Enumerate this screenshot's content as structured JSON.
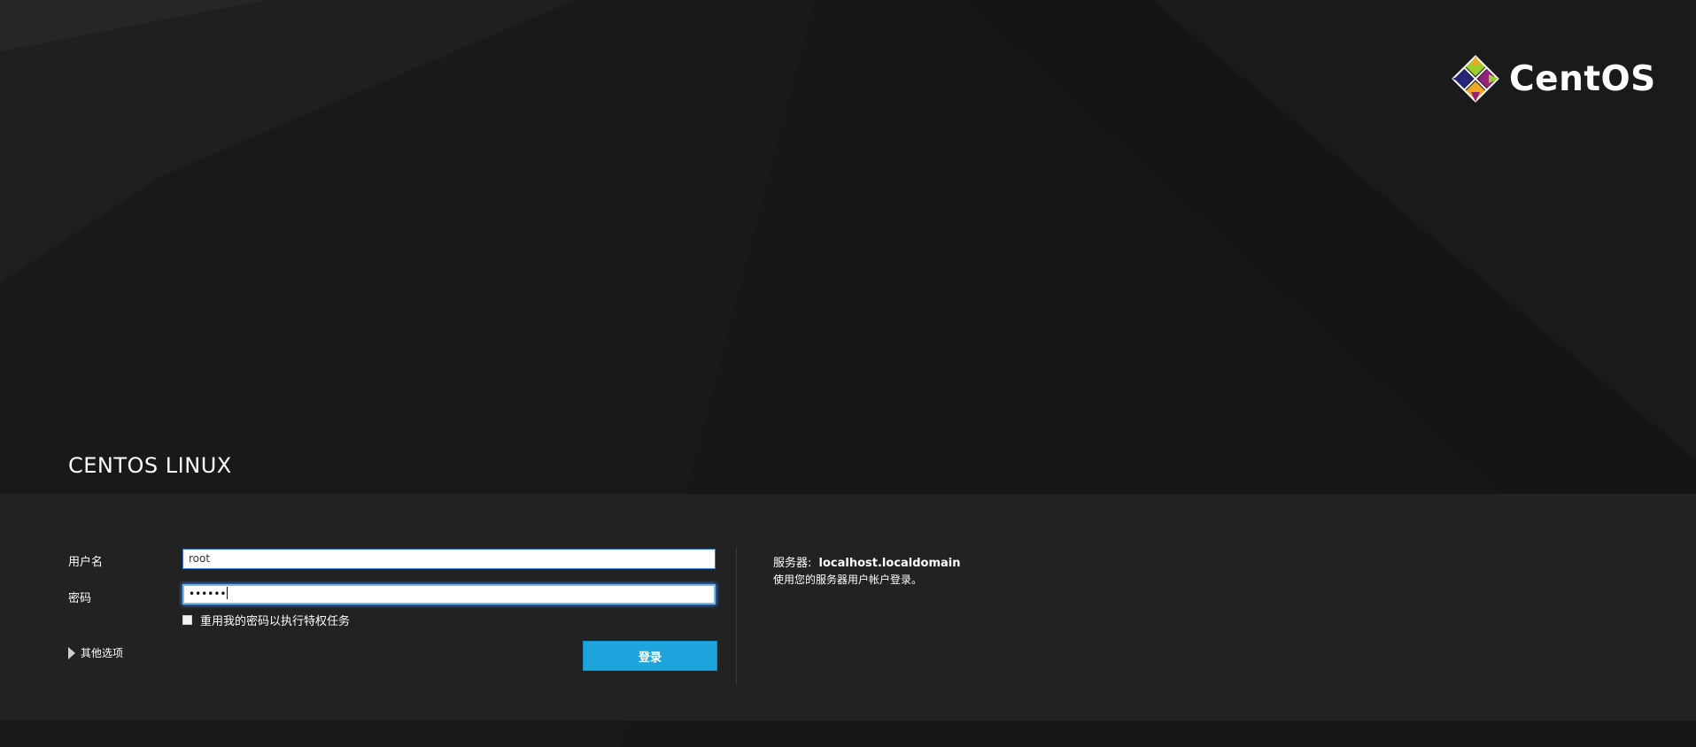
{
  "page": {
    "brand_title": "CENTOS LINUX"
  },
  "logo": {
    "wordmark": "CentOS"
  },
  "login": {
    "username_label": "用户名",
    "username_value": "root",
    "password_label": "密码",
    "password_masked": "••••••",
    "reuse_password_label": "重用我的密码以执行特权任务",
    "more_options_label": "其他选项",
    "submit_label": "登录"
  },
  "server": {
    "label": "服务器:",
    "hostname": "localhost.localdomain",
    "help": "使用您的服务器用户帐户登录。"
  },
  "colors": {
    "background": "#151515",
    "panel": "#222222",
    "accent_blue": "#1ea4dc",
    "focus_blue": "#73b8f0",
    "centos_green": "#9ccd2a",
    "centos_purple": "#932279",
    "centos_yellow": "#efa724",
    "centos_blue": "#262577"
  },
  "icons": {
    "logo_mark": "centos-logo-icon",
    "disclosure": "triangle-right-icon",
    "checkbox": "checkbox-unchecked-icon"
  }
}
